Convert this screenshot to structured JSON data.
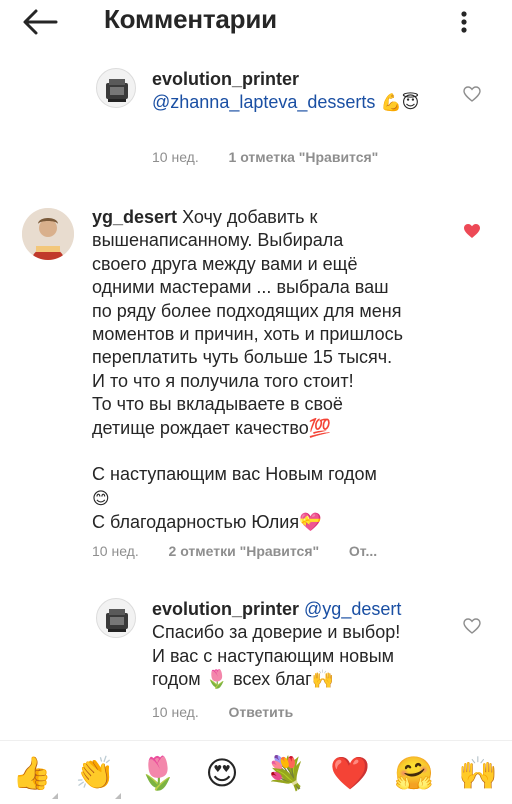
{
  "header": {
    "title": "Комментарии"
  },
  "comments": [
    {
      "username": "evolution_printer",
      "mention": "@zhanna_lapteva_desserts",
      "emojis": "💪😇",
      "time": "10 нед.",
      "likes": "1 отметка \"Нравится\"",
      "liked": false
    },
    {
      "username": "yg_desert",
      "lines": [
        "Хочу добавить к",
        "вышенаписанному. Выбирала",
        "своего друга между вами и ещё",
        "одними мастерами ... выбрала ваш",
        "по ряду более подходящих для меня",
        "моментов и причин, хоть и пришлось",
        "переплатить чуть больше 15 тысяч.",
        "И то что я получила  того стоит!",
        "То что вы вкладываете в своё",
        "детище рождает качество💯",
        "",
        "С наступающим вас Новым годом",
        "😊",
        "С благодарностью Юлия💝"
      ],
      "time": "10 нед.",
      "likes": "2 отметки \"Нравится\"",
      "reply": "От...",
      "liked": true
    },
    {
      "username": "evolution_printer",
      "mention": "@yg_desert",
      "lines": [
        "Спасибо за доверие и выбор!",
        "И вас с наступающим новым",
        "годом 🌷 всех благ🙌"
      ],
      "time": "10 нед.",
      "reply": "Ответить",
      "liked": false
    }
  ],
  "emoji_bar": [
    "👍",
    "👏",
    "🌷",
    "😍",
    "💐",
    "❤️",
    "🤗",
    "🙌"
  ],
  "colors": {
    "text": "#262626",
    "muted": "#8e8e8e",
    "mention": "#1a4fa3",
    "heart": "#ed4956"
  }
}
